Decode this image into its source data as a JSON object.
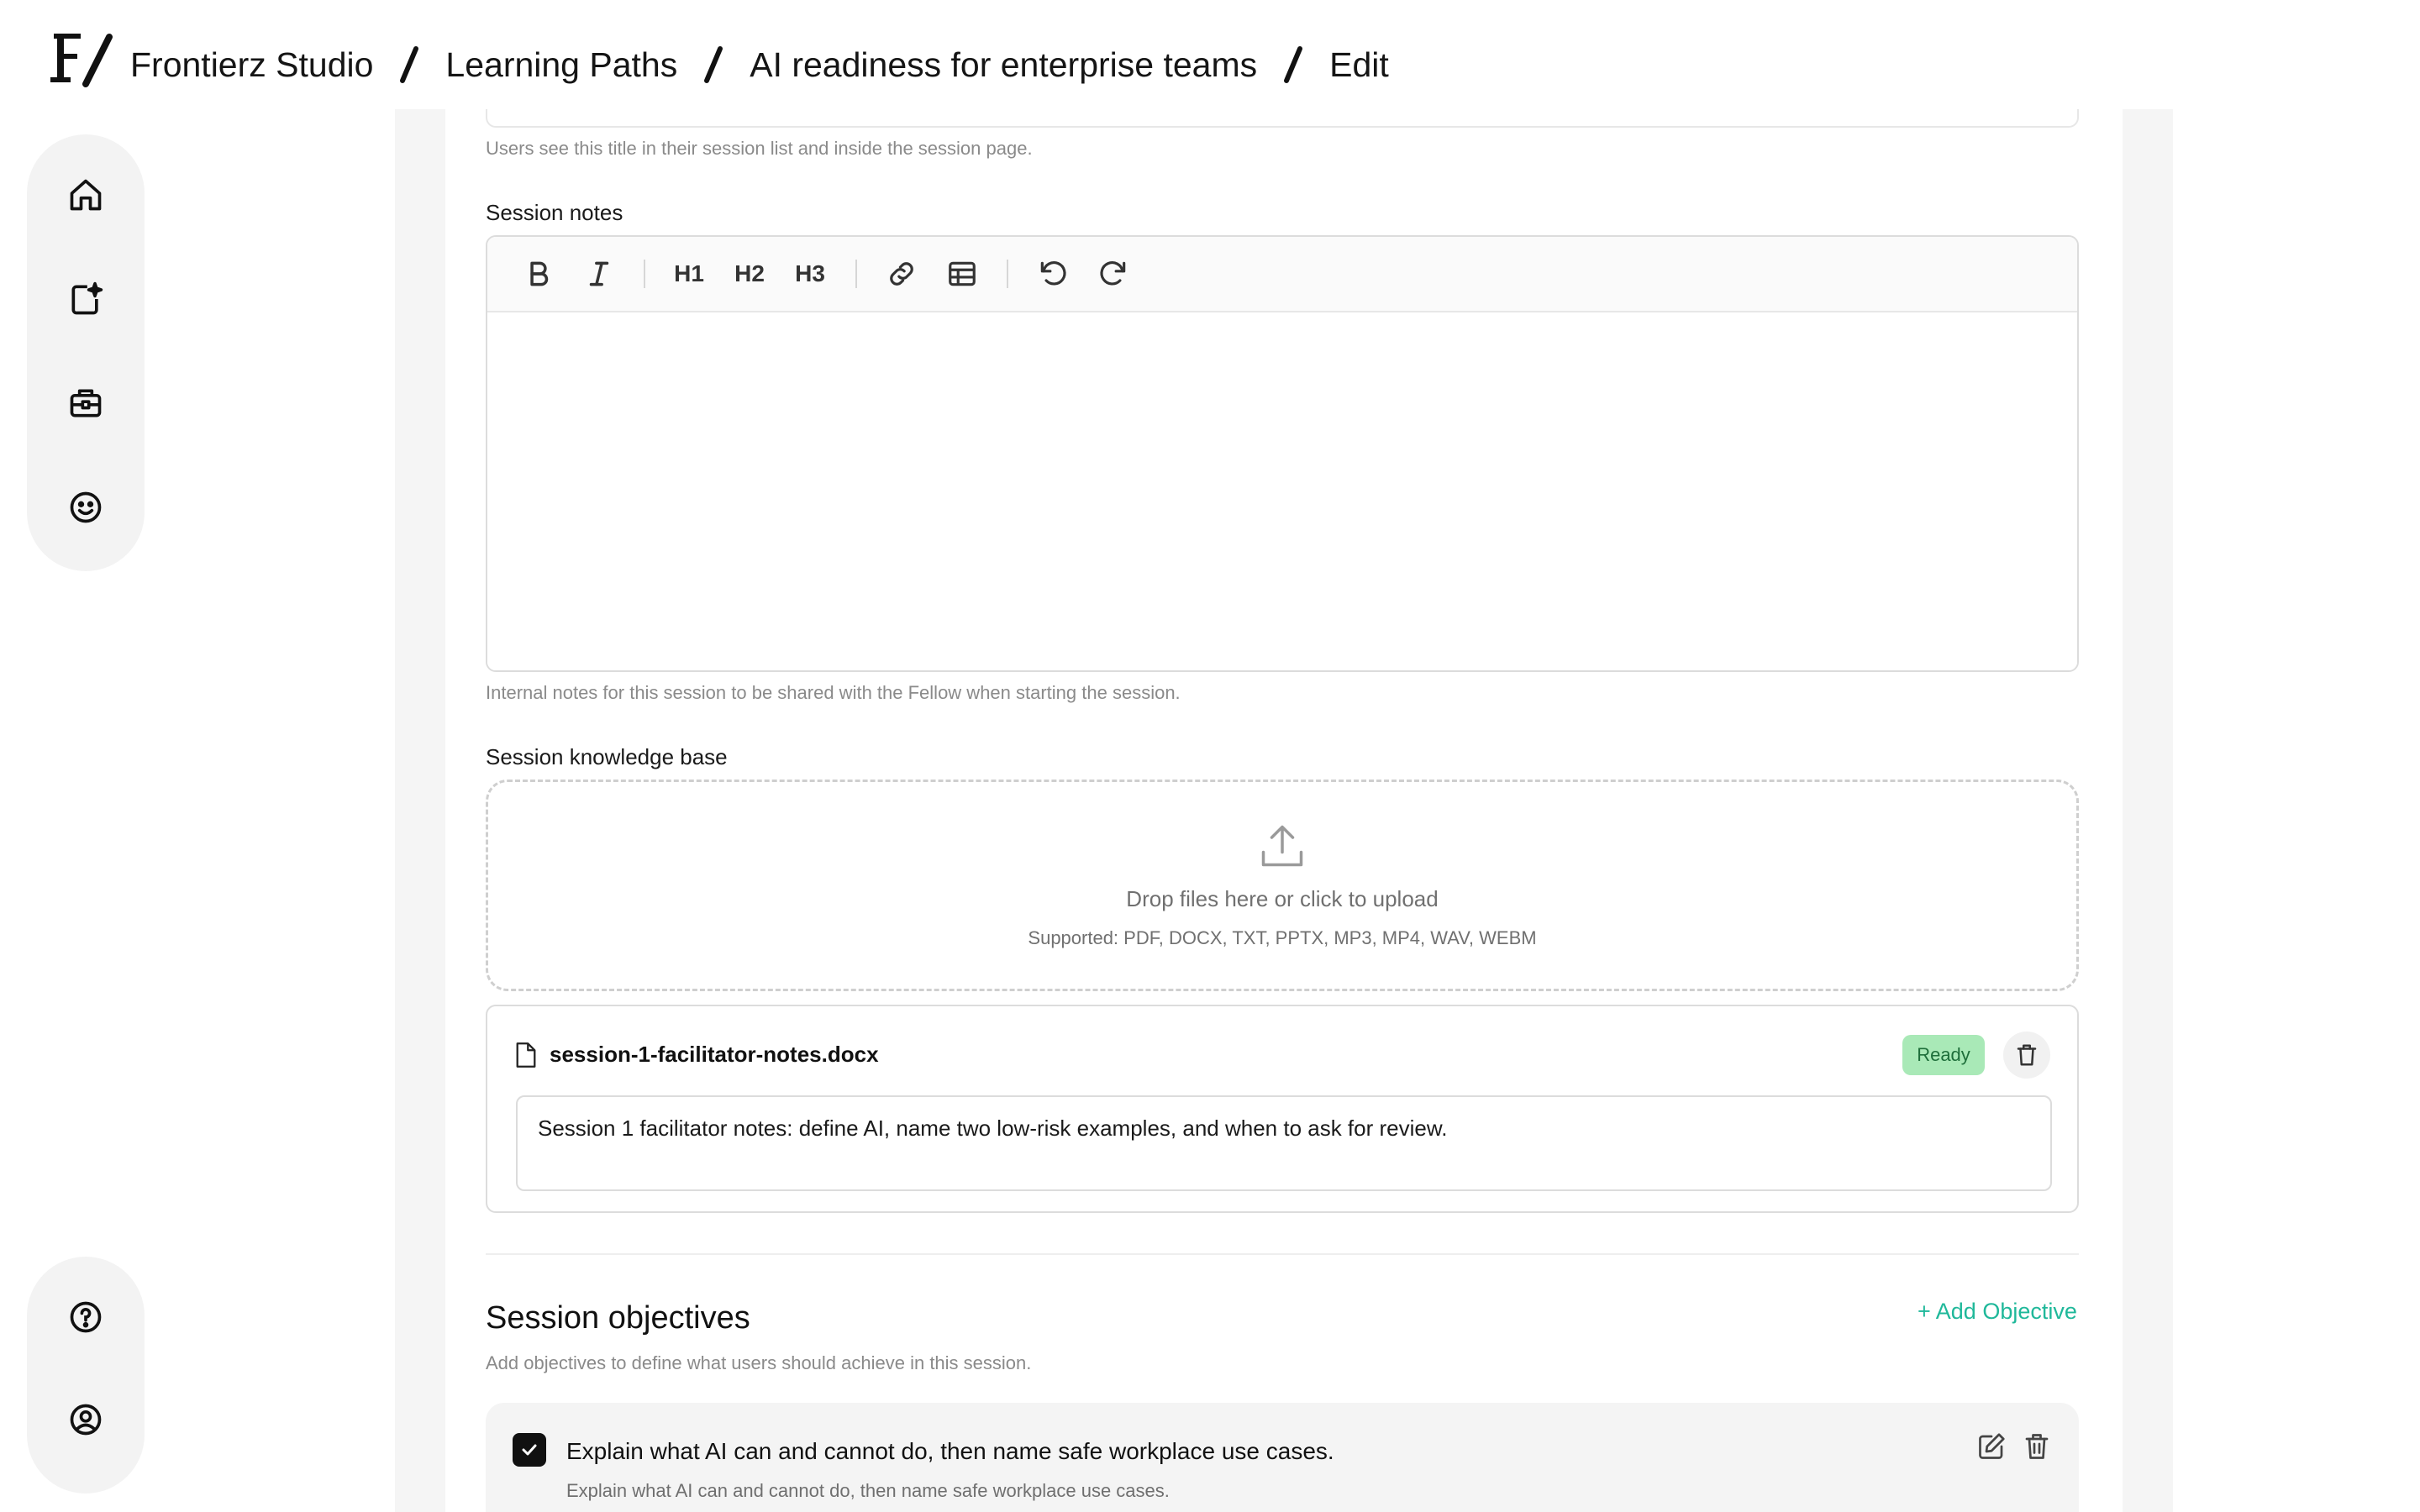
{
  "colors": {
    "accent": "#1fb89a",
    "ready_bg": "#a9e9b7",
    "ready_fg": "#1f6f3b"
  },
  "breadcrumb": {
    "items": [
      "Frontierz Studio",
      "Learning Paths",
      "AI readiness for enterprise teams",
      "Edit"
    ]
  },
  "sidebar": {
    "top": [
      {
        "icon": "home-icon"
      },
      {
        "icon": "sparkle-document-icon"
      },
      {
        "icon": "briefcase-icon"
      },
      {
        "icon": "smiley-icon"
      }
    ],
    "bottom": [
      {
        "icon": "help-icon"
      },
      {
        "icon": "user-circle-icon"
      }
    ]
  },
  "title_field": {
    "help": "Users see this title in their session list and inside the session page."
  },
  "notes": {
    "label": "Session notes",
    "toolbar": {
      "h1": "H1",
      "h2": "H2",
      "h3": "H3"
    },
    "help": "Internal notes for this session to be shared with the Fellow when starting the session."
  },
  "knowledge_base": {
    "label": "Session knowledge base",
    "drop_text": "Drop files here or click to upload",
    "supported": "Supported: PDF, DOCX, TXT, PPTX, MP3, MP4, WAV, WEBM",
    "file": {
      "name": "session-1-facilitator-notes.docx",
      "status": "Ready",
      "note": "Session 1 facilitator notes: define AI, name two low-risk examples, and when to ask for review."
    }
  },
  "objectives": {
    "title": "Session objectives",
    "add_label": "+ Add Objective",
    "help": "Add objectives to define what users should achieve in this session.",
    "items": [
      {
        "title": "Explain what AI can and cannot do, then name safe workplace use cases.",
        "description": "Explain what AI can and cannot do, then name safe workplace use cases.",
        "checked": true
      }
    ]
  }
}
